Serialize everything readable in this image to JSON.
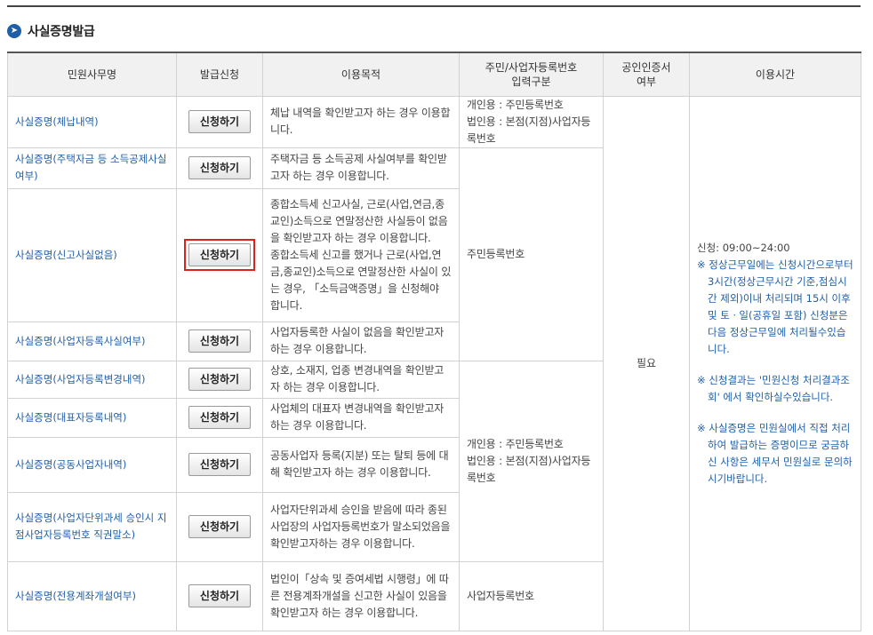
{
  "section_title": "사실증명발급",
  "headers": {
    "name": "민원사무명",
    "apply": "발급신청",
    "purpose": "이용목적",
    "input_type_l1": "주민/사업자등록번호",
    "input_type_l2": "입력구분",
    "cert_l1": "공인인증서",
    "cert_l2": "여부",
    "time": "이용시간"
  },
  "apply_label": "신청하기",
  "rows": [
    {
      "name": "사실증명(체납내역)",
      "purpose": "체납 내역을 확인받고자 하는 경우 이용합니다."
    },
    {
      "name": "사실증명(주택자금 등 소득공제사실여부)",
      "purpose": "주택자금 등 소득공제 사실여부를 확인받고자 하는 경우 이용합니다."
    },
    {
      "name": "사실증명(신고사실없음)",
      "purpose": "종합소득세 신고사실, 근로(사업,연금,종교인)소득으로 연말정산한 사실등이 없음을 확인받고자 하는 경우 이용합니다.",
      "purpose2": "종합소득세 신고를 했거나 근로(사업,연금,종교인)소득으로 연말정산한 사실이 있는 경우, 「소득금액증명」을 신청해야 합니다."
    },
    {
      "name": "사실증명(사업자등록사실여부)",
      "purpose": "사업자등록한 사실이 없음을 확인받고자 하는 경우 이용합니다."
    },
    {
      "name": "사실증명(사업자등록변경내역)",
      "purpose": "상호, 소재지, 업종 변경내역을 확인받고자 하는 경우 이용합니다."
    },
    {
      "name": "사실증명(대표자등록내역)",
      "purpose": "사업체의 대표자 변경내역을 확인받고자 하는 경우 이용합니다."
    },
    {
      "name": "사실증명(공동사업자내역)",
      "purpose": "공동사업자 등록(지분) 또는 탈퇴 등에 대해 확인받고자 하는 경우 이용합니다."
    },
    {
      "name": "사실증명(사업자단위과세 승인시 지점사업자등록번호 직권말소)",
      "purpose": "사업자단위과세 승인을 받음에 따라 종된 사업장의 사업자등록번호가 말소되었음을 확인받고자하는 경우 이용합니다."
    },
    {
      "name": "사실증명(전용계좌개설여부)",
      "purpose": "법인이「상속 및 증여세법 시행령」에 따른 전용계좌개설을 신고한 사실이 있음을 확인받고자 하는 경우 이용합니다."
    }
  ],
  "input_types": {
    "group1_l1": "개인용 : 주민등록번호",
    "group1_l2": "법인용 : 본점(지점)사업자등록번호",
    "group2": "주민등록번호",
    "group3_l1": "개인용 : 주민등록번호",
    "group3_l2": "법인용 : 본점(지점)사업자등록번호",
    "group4": "사업자등록번호"
  },
  "cert_value": "필요",
  "time_info": {
    "hours": "신청: 09:00~24:00",
    "note1": "※ 정상근무일에는 신청시간으로부터 3시간(정상근무시간 기준,점심시간 제외)이내 처리되며 15시 이후 및 토ㆍ일(공휴일 포함) 신청분은 다음 정상근무일에 처리될수있습니다.",
    "note2": "※ 신청결과는 '민원신청 처리결과조회' 에서 확인하실수있습니다.",
    "note3": "※ 사실증명은 민원실에서 직접 처리하여 발급하는 증명이므로 궁금하신 사항은 세무서 민원실로 문의하시기바랍니다."
  }
}
